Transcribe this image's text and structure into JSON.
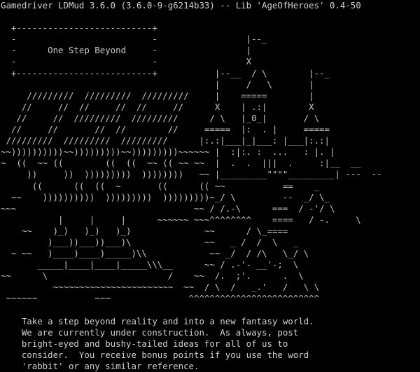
{
  "terminal": {
    "status_line": "Gamedriver LDMud 3.6.0 (3.6.0-9-g6214b33) -- Lib 'AgeOfHeroes' 0.4-50",
    "banner_lines": [
      "",
      "  +--------------------------+",
      "  -                          -                 |--_",
      "  -      One Step Beyond     -                 |",
      "  -                          -                 X",
      "  +--------------------------+           |--__  / \\        |--_",
      "                                         |     /   \\       |",
      "     /////////  /////////  /////////     |    =====        |",
      "    //     //  //     //  //     //      X    | .:|        X",
      "   //     //  /////////  /////////      / \\   |_0_|       / \\",
      "  //     //       //  //        //     =====  |:  . |     =====",
      " /////////  /////////  /////////      |:.:|___|_|___: |___|:.:|",
      "~~))))))))))~~)))))))))~~)))))))))~~~~~~ |  :|:. :  ...   : |. |",
      "~  ((  ~~ ((        ((  ((  ~~ (( ~~ ~~  |  .  .  |||  .     :|__  __",
      "     ))     ))  )))))))))  ))))))))   ~~ |_________\"\"\"\"_________| ---  --",
      "      ((      ((  ((  ~       ((      (( ~~           ==    _",
      "  ~~    ))))))))))  )))))))))  )))))))))~_/ \\         --  _/ \\_",
      "~~~                                  ~~ / /.-\\      ===  / -'/ \\",
      "           |     |     |      ~~~~~~ ~~~^^^^^^^^    ====   / -.     \\",
      "    ~~    )_)   )_)   )_)              ~~      / \\_====",
      "         )___))___))___)\\              ~~   _ /  /  \\   _",
      "  ~ ~~   )____)____)_____)\\\\            ~~ _/  / /\\   \\_/ \\",
      "       _____|____|____|_____\\\\\\__      ~~ / .-'- __'-;  \\",
      "~~      \\                       /    ~~  /.  ;'.      .  \\",
      "          ~~~~~~~~~~~~~~~~~~~~~~~  ~~  / \\  /   _.'   /   \\ \\",
      " ~~~~~~           ~~~               ^^^^^^^^^^^^^^^^^^^^^^^^^",
      ""
    ],
    "welcome_lines": [
      "    Take a step beyond reality and into a new fantasy world.",
      "    We are currently under construction.  As always, post",
      "    bright-eyed and bushy-tailed ideas for all of us to",
      "    consider.  You receive bonus points if you use the word",
      "    'rabbit' or any similar reference."
    ]
  }
}
